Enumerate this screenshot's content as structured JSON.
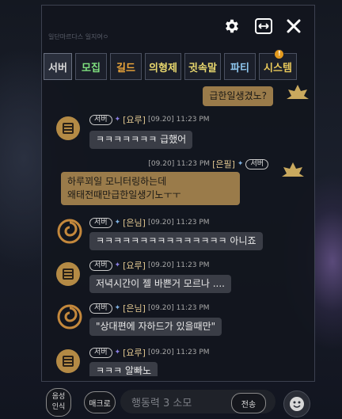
{
  "header": {
    "ghost_text": "일단마르다스 일지여ㅇ",
    "icons": [
      "gear-icon",
      "expand-horizontal-icon",
      "close-icon"
    ]
  },
  "tabs": [
    {
      "label": "서버",
      "color": "#d8d8d8",
      "active": true
    },
    {
      "label": "모집",
      "color": "#7fe07f",
      "active": false
    },
    {
      "label": "길드",
      "color": "#f0a83a",
      "active": false
    },
    {
      "label": "의형제",
      "color": "#e9d86e",
      "active": false
    },
    {
      "label": "귓속말",
      "color": "#e9d86e",
      "active": false
    },
    {
      "label": "파티",
      "color": "#8fc8f0",
      "active": false
    },
    {
      "label": "시스템",
      "color": "#e8c85a",
      "active": false,
      "notification": "!"
    }
  ],
  "messages": [
    {
      "type": "me",
      "text": "급한일생겼노?"
    },
    {
      "type": "other",
      "badge": "서버",
      "name": "[요루]",
      "time": "[09.20] 11:23 PM",
      "text": "ㅋㅋㅋㅋㅋㅋㅋ 급했어"
    },
    {
      "type": "me_full",
      "badge": "서버",
      "name": "[은필]",
      "time": "[09.20] 11:23 PM",
      "line1": "하루꾀일 모니터링하는데",
      "line2": "왜태전때만급한일생기노ㅜㅜ"
    },
    {
      "type": "other",
      "badge": "서버",
      "name": "[은님]",
      "time": "[09.20] 11:23 PM",
      "text": "ㅋㅋㅋㅋㅋㅋㅋㅋㅋㅋㅋㅋㅋㅋㅋ 아니죠"
    },
    {
      "type": "other",
      "badge": "서버",
      "name": "[요루]",
      "time": "[09.20] 11:23 PM",
      "text": "저녁시간이 젤 바쁜거 모르나 ...."
    },
    {
      "type": "other",
      "badge": "서버",
      "name": "[은님]",
      "time": "[09.20] 11:23 PM",
      "text": "\"상대편에 자하드가 있을때만\""
    },
    {
      "type": "other",
      "badge": "서버",
      "name": "[요루]",
      "time": "[09.20] 11:23 PM",
      "text": "ㅋㅋㅋ 알빠노"
    }
  ],
  "bottom": {
    "voice_line1": "음성",
    "voice_line2": "인식",
    "macro": "매크로",
    "input_placeholder": "행동력 3 소모",
    "send": "전송"
  },
  "colors": {
    "name": "#e0c690",
    "me_bubble": "#9a7b4a",
    "other_bubble": "#3a3d46"
  }
}
